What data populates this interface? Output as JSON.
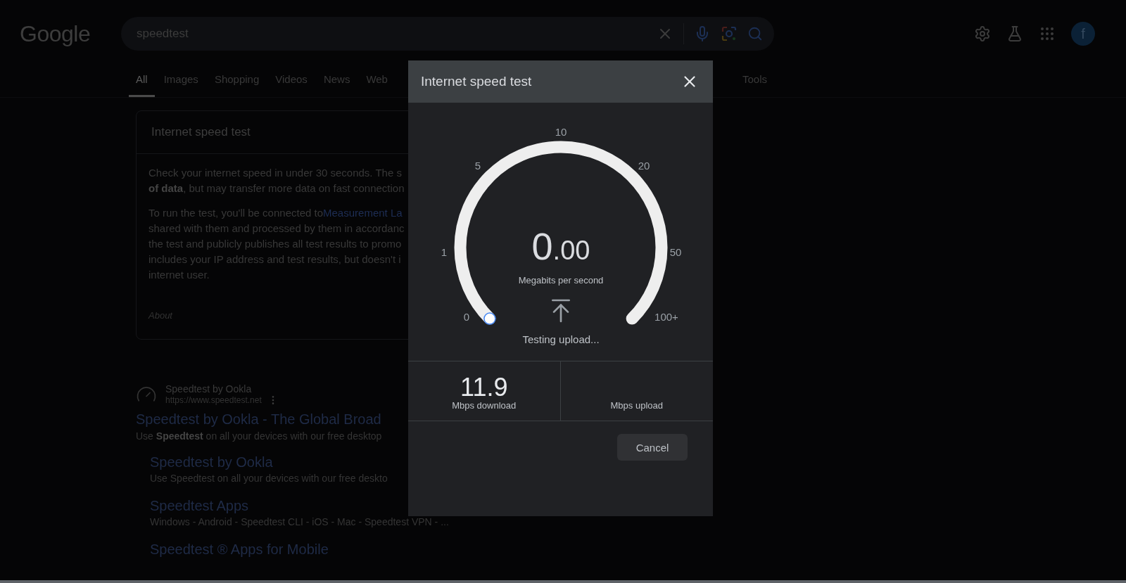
{
  "header": {
    "logo": "Google",
    "search": {
      "value": "speedtest"
    },
    "avatar": "f"
  },
  "tabs": [
    {
      "label": "All",
      "selected": true
    },
    {
      "label": "Images",
      "selected": false
    },
    {
      "label": "Shopping",
      "selected": false
    },
    {
      "label": "Videos",
      "selected": false
    },
    {
      "label": "News",
      "selected": false
    },
    {
      "label": "Web",
      "selected": false
    }
  ],
  "tools": "Tools",
  "card": {
    "title": "Internet speed test",
    "paragraphs": [
      {
        "lines": [
          {
            "text": "Check your internet speed in under 30 seconds. The s"
          },
          {
            "text": "**of data**, but may transfer more data on fast connection"
          }
        ]
      },
      {
        "lines": [
          {
            "text": "To run the test, you'll be connected to ",
            "link": "Measurement La"
          },
          {
            "text": "shared with them and processed by them in accordanc"
          },
          {
            "text": "the test and publicly publishes all test results to promo"
          },
          {
            "text": "includes your IP address and test results, but doesn't i"
          },
          {
            "text": "internet user."
          }
        ]
      }
    ],
    "about": "About"
  },
  "result": {
    "site": "Speedtest by Ookla",
    "url": "https://www.speedtest.net",
    "title": "Speedtest by Ookla - The Global Broad",
    "snippet": "Use **Speedtest** on all your devices with our free desktop",
    "sitelinks": [
      {
        "title": "Speedtest by Ookla",
        "snippet": "Use Speedtest on all your devices with our free deskto"
      },
      {
        "title": "Speedtest Apps",
        "snippet": "Windows - Android - Speedtest CLI - iOS - Mac - Speedtest VPN - ..."
      },
      {
        "title": "Speedtest ® Apps for Mobile"
      }
    ]
  },
  "modal": {
    "title": "Internet speed test",
    "gauge": {
      "scale": [
        "0",
        "1",
        "5",
        "10",
        "20",
        "50",
        "100+"
      ],
      "reading_whole": "0",
      "reading_fraction": ".00",
      "unit": "Megabits per second",
      "status": "Testing upload..."
    },
    "stats": [
      {
        "value": "11.9",
        "label": "Mbps download"
      },
      {
        "label": "Mbps upload"
      }
    ],
    "cancel": "Cancel"
  }
}
